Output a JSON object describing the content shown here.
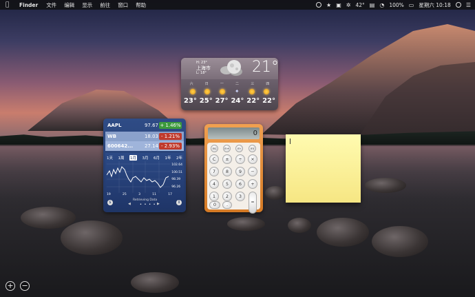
{
  "menubar": {
    "apple_icon": "apple-logo-icon",
    "app_name": "Finder",
    "items": [
      "文件",
      "编辑",
      "显示",
      "前往",
      "窗口",
      "帮助"
    ],
    "status": {
      "temperature": "42°",
      "battery": "100%",
      "datetime": "星期六 10:18"
    }
  },
  "weather": {
    "high": "H: 23°",
    "city": "上海市",
    "low": "L: 18°",
    "current_temp": "21°",
    "days": [
      "六",
      "日",
      "一",
      "二",
      "三",
      "四"
    ],
    "temps": [
      "23°",
      "25°",
      "27°",
      "24°",
      "22°",
      "22°"
    ]
  },
  "stocks": {
    "rows": [
      {
        "symbol": "AAPL",
        "price": "97.67",
        "change": "+ 1.46%",
        "direction": "up"
      },
      {
        "symbol": "WB",
        "price": "18.03",
        "change": "- 1.21%",
        "direction": "down"
      },
      {
        "symbol": "600642...",
        "price": "27.14",
        "change": "- 2.93%",
        "direction": "down"
      }
    ],
    "ranges": [
      "1天",
      "1周",
      "1月",
      "3月",
      "6月",
      "1年",
      "2年"
    ],
    "selected_range": "1月",
    "y_ticks": [
      "102.64",
      "100.51",
      "98.39",
      "96.26"
    ],
    "x_ticks": [
      "19",
      "25",
      "3",
      "11",
      "17"
    ],
    "caption": "Retrieving Data",
    "page_dots": "• • • •"
  },
  "calculator": {
    "display": "0",
    "memory_row": [
      "mc",
      "m+",
      "m-",
      "mr"
    ],
    "buttons": [
      "C",
      "±",
      "÷",
      "×",
      "7",
      "8",
      "9",
      "−",
      "4",
      "5",
      "6",
      "+",
      "1",
      "2",
      "3",
      "0",
      ".",
      "="
    ]
  },
  "sticky": {
    "text": ""
  },
  "dashboard": {
    "add_label": "+",
    "remove_label": "−"
  }
}
